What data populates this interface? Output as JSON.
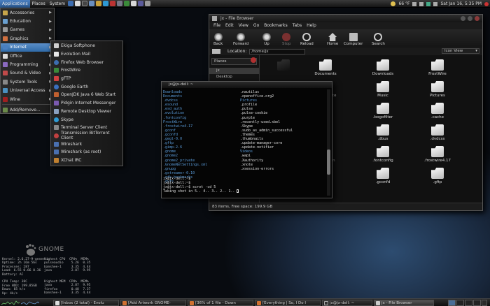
{
  "top_panel": {
    "menus": [
      "Applications",
      "Places",
      "System"
    ],
    "tray": {
      "temperature": "66 °F",
      "clock": "Sat Jan 16,  5:35 PM"
    }
  },
  "apps_menu": {
    "items": [
      {
        "label": "Accessories"
      },
      {
        "label": "Education"
      },
      {
        "label": "Games"
      },
      {
        "label": "Graphics"
      },
      {
        "label": "Internet"
      },
      {
        "label": "Office"
      },
      {
        "label": "Programming"
      },
      {
        "label": "Sound & Video"
      },
      {
        "label": "System Tools"
      },
      {
        "label": "Universal Access"
      },
      {
        "label": "Wine"
      }
    ],
    "footer": "Add/Remove..."
  },
  "internet_menu": {
    "items": [
      "Ekiga Softphone",
      "Evolution Mail",
      "Firefox Web Browser",
      "FrostWire",
      "gFTP",
      "Google Earth",
      "OpenJDK Java 6 Web Start",
      "Pidgin Internet Messenger",
      "Remote Desktop Viewer",
      "Skype",
      "Terminal Server Client",
      "Transmission BitTorrent Client",
      "Wireshark",
      "Wireshark (as root)",
      "XChat IRC"
    ]
  },
  "file_browser": {
    "title": "jx - File Browser",
    "menubar": [
      "File",
      "Edit",
      "View",
      "Go",
      "Bookmarks",
      "Tabs",
      "Help"
    ],
    "toolbar": [
      "Back",
      "Forward",
      "Up",
      "Stop",
      "Reload",
      "Home",
      "Computer",
      "Search"
    ],
    "location_label": "Location:",
    "location_value": "/home/jx",
    "view_mode": "Icon View",
    "places_header": "Places",
    "side_items": [
      "jx",
      "Desktop"
    ],
    "grid_items": [
      "",
      "Documents",
      "Downloads",
      "FrostWire",
      "",
      "Incomplete",
      "Music",
      "Pictures",
      "",
      ".adobe",
      ".bogofilter",
      ".cache",
      "",
      ".config",
      ".dbus",
      ".dvdcss",
      "",
      ".evolution",
      ".fontconfig",
      ".frostwire4.17",
      "",
      ".gconf",
      ".gconfd",
      ".gftp"
    ],
    "status": "83 items, Free space: 199.9 GB"
  },
  "terminal": {
    "title": "jx@jx-dell: ~",
    "col1": [
      "Documents",
      ".dvdcss",
      ".esound",
      ".esd_auth",
      ".evolution",
      ".fontconfig",
      "FrostWire",
      ".frostwire4.17",
      ".gconf",
      ".gconfd",
      ".gegl-0.0",
      ".gftp",
      ".gimp-2.6",
      ".gnome",
      ".gnome2",
      ".gnome2_private",
      ".GnomeNetSettings.xml",
      ".gnupg",
      ".gstreamer-0.10",
      ".gtk-bookmarks",
      ".gvfs"
    ],
    "col1_top": "Downloads",
    "col2": [
      ".nautilus",
      ".openoffice.org2",
      "Pictures",
      ".profile",
      ".pulse",
      ".pulse-cookie",
      ".purple",
      ".recently-used.xbel",
      ".Skype",
      ".sudo_as_admin_successful",
      ".themes",
      ".thumbnails",
      ".update-manager-core",
      ".update-notifier",
      "Videos",
      ".wapi",
      ".Xauthority",
      ".xnote",
      ".xsession-errors"
    ],
    "prompt_lines": [
      "jx@jx-dell:~$",
      "jx@jx-dell:~$",
      "jx@jx-dell:~$ scrot -cd 5",
      "Taking shot in 5.. 4.. 3.. 2.. 1.. "
    ]
  },
  "gnome_label": "GNOME",
  "conky": {
    "left": [
      "Kernel: 2.6.27-9-generic",
      "Uptime: 2h 16m 56s",
      "Processes: 287",
      "Load: 6.55 0.66 0.36",
      "Battery: AC",
      "",
      "CPU Temp: 38C",
      "Free HDD: 199.85GB",
      "Down: 85 k/s",
      "Up: 4k/s"
    ],
    "cpu_header": "Highest CPU  CPU%  MEM%",
    "cpu_rows": [
      "pulseaudio    5.26  0.35",
      "banshee-1     3.35  4.44",
      "java          2.87  9.95"
    ],
    "mem_header": "Highest MEM  CPU%  MEM%",
    "mem_rows": [
      "java          2.87  9.95",
      "firefox       0.48  7.37",
      "banshee-1     3.35  4.44"
    ]
  },
  "bottom_panel": {
    "tasks": [
      "[Inbox (2 total) - Evolu",
      "[Add Artwork GNOME-",
      "[36% of 1 file - Down",
      "[Everything | So, I Do I",
      "jx@jx-dell: ~",
      "jx - File Browser"
    ]
  },
  "colors": {
    "accent": "#2f6aa8",
    "terminal_blue": "#5a9bd9"
  }
}
